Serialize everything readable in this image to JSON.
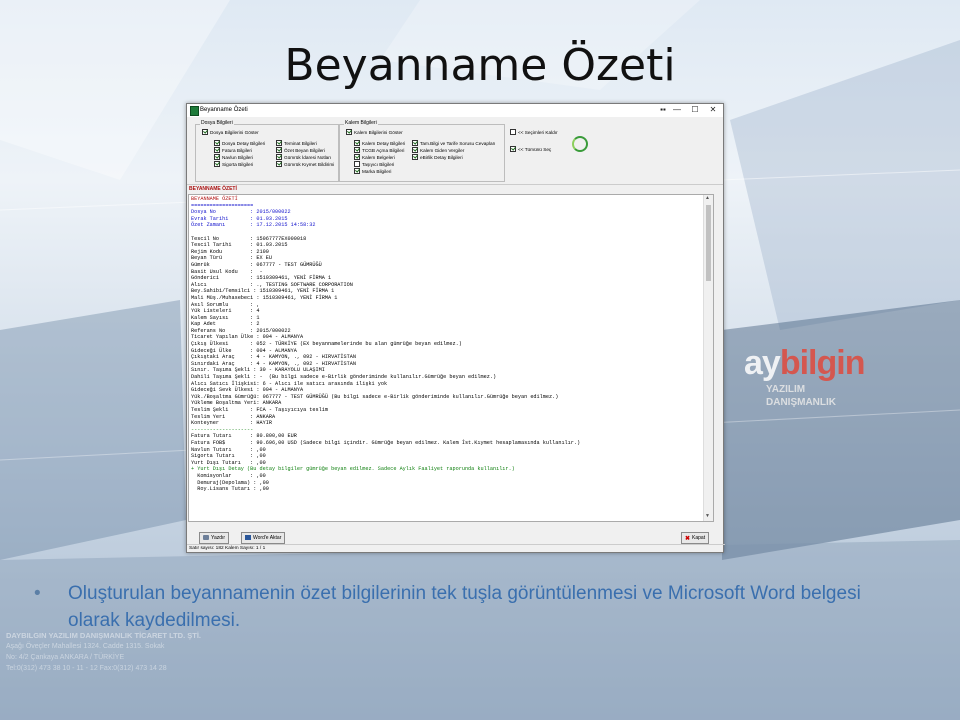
{
  "slide": {
    "title": "Beyanname Özeti",
    "bullet": "Oluşturulan beyannamenin özet bilgilerinin tek tuşla görüntülenmesi ve Microsoft Word belgesi olarak kaydedilmesi.",
    "bullet_mark": "•",
    "watermark_logo_a": "ay",
    "watermark_logo_b": "bilgin",
    "watermark_sub1": "YAZILIM",
    "watermark_sub2": "DANIŞMANLIK",
    "company_lines": [
      "DAYBILGIN YAZILIM DANIŞMANLIK TİCARET LTD. ŞTİ.",
      "Aşağı Öveçler Mahallesi 1324. Cadde 1315. Sokak",
      "No: 4/2 Çankaya ANKARA / TÜRKİYE",
      "Tel:0(312) 473 38 10 - 11 - 12 Fax:0(312) 473 14 28"
    ]
  },
  "window": {
    "title": "Beyanname Özeti",
    "controls": [
      "▪▪",
      "—",
      "☐",
      "✕"
    ],
    "dosya_group": {
      "label": "Dosya Bilgileri",
      "show": "Dosya Bilgilerini Göster",
      "items_left": [
        "Dosya Detay Bilgileri",
        "Fatura Bilgileri",
        "Navlun Bilgileri",
        "Sigorta Bilgileri"
      ],
      "items_right": [
        "Teminat Bilgileri",
        "Özet Beyan Bilgileri",
        "Gümrük İdaresi Notları",
        "Gümrük Kıymet Bildirimi"
      ]
    },
    "kalem_group": {
      "label": "Kalem Bilgileri",
      "show": "Kalem Bilgilerini Göster",
      "items_left": [
        "Kalem Detay Bilgileri",
        "TCGB Açma Bilgileri",
        "Kalem Belgeleri",
        "Taşıyıcı Bilgileri",
        "Marka Bilgileri"
      ],
      "items_right": [
        "Tam.Bilgi ve Tarife Sorusu Cevapları",
        "Kalem Giden Vergiler",
        "eBirlik Detay Bilgileri"
      ]
    },
    "secimleri_kaldir": "<< Seçimleri Kaldır",
    "tumunu_sec": "<< Tümünü Seç",
    "panel_title": "BEYANNAME ÖZETİ",
    "report_lines": [
      {
        "t": "BEYANNAME ÖZETİ",
        "c": "red"
      },
      {
        "t": "====================",
        "c": "blue"
      },
      {
        "t": "Dosya No           : 2015/000022",
        "c": "blue"
      },
      {
        "t": "Evrak Tarihi       : 01.03.2015",
        "c": "blue"
      },
      {
        "t": "Özet Zamanı        : 17.12.2015 14:58:32",
        "c": "blue"
      },
      {
        "t": " ",
        "c": ""
      },
      {
        "t": "Tescil No          : 15067777EX000018",
        "c": ""
      },
      {
        "t": "Tescil Tarihi      : 01.03.2015",
        "c": ""
      },
      {
        "t": "Rejim Kodu         : 2100",
        "c": ""
      },
      {
        "t": "Beyan Türü         : EX EU",
        "c": ""
      },
      {
        "t": "Gümrük             : 067777 - TEST GÜMRÜĞÜ",
        "c": ""
      },
      {
        "t": "Basit Usul Kodu    :  -",
        "c": ""
      },
      {
        "t": "Gönderici          : 1510309461, YENİ FİRMA 1",
        "c": ""
      },
      {
        "t": "Alıcı              : ., TESTING SOFTWARE CORPORATION",
        "c": ""
      },
      {
        "t": "Bey.Sahibi/Temsilci : 1510309461, YENİ FİRMA 1",
        "c": ""
      },
      {
        "t": "Mali Müş./Muhasebeci : 1510309461, YENİ FİRMA 1",
        "c": ""
      },
      {
        "t": "Asıl Sorumlu       : ,",
        "c": ""
      },
      {
        "t": "Yük Listeleri      : 4",
        "c": ""
      },
      {
        "t": "Kalem Sayısı       : 1",
        "c": ""
      },
      {
        "t": "Kap Adet           : 2",
        "c": ""
      },
      {
        "t": "Referans No        : 2015/000022",
        "c": ""
      },
      {
        "t": "Ticaret Yapılan Ülke : 004 - ALMANYA",
        "c": ""
      },
      {
        "t": "Çıkış Ülkesi       : 052 - TÜRKİYE (EX beyannamelerinde bu alan gümrüğe beyan edilmez.)",
        "c": ""
      },
      {
        "t": "Gideceği Ülke      : 004 - ALMANYA",
        "c": ""
      },
      {
        "t": "Çıkıştaki Araç     : 4 - KAMYON, ., 092 - HIRVATİSTAN",
        "c": ""
      },
      {
        "t": "Sınırdaki Araç     : 4 - KAMYON, ., 092 - HIRVATİSTAN",
        "c": ""
      },
      {
        "t": "Sınır. Taşıma Şekli : 30 - KARAYOLU ULAŞIMI",
        "c": ""
      },
      {
        "t": "Dahili Taşıma Şekli : -  (Bu bilgi sadece e-Birlik gönderiminde kullanılır.Gümrüğe beyan edilmez.)",
        "c": ""
      },
      {
        "t": "Alıcı Satıcı İlişkisi: 6 - Alıcı ile satıcı arasında ilişki yok",
        "c": ""
      },
      {
        "t": "Gideceği Sevk Ülkesi : 004 - ALMANYA",
        "c": ""
      },
      {
        "t": "Yük./Boşaltma Gümrüğü: 067777 - TEST GÜMRÜĞÜ (Bu bilgi sadece e-Birlik gönderiminde kullanılır.Gümrüğe beyan edilmez.)",
        "c": ""
      },
      {
        "t": "Yükleme Boşaltma Yeri: ANKARA",
        "c": ""
      },
      {
        "t": "Teslim Şekli       : FCA - Taşıyıcıya teslim",
        "c": ""
      },
      {
        "t": "Teslim Yeri        : ANKARA",
        "c": ""
      },
      {
        "t": "Konteyner          : HAYIR",
        "c": ""
      },
      {
        "t": "--------------------",
        "c": "grn"
      },
      {
        "t": "Fatura Tutarı      : 80.800,00 EUR",
        "c": ""
      },
      {
        "t": "Fatura FOB$        : 90.696,00 USD (Sadece bilgi içindir. Gümrüğe beyan edilmez. Kalem İst.Kıymet hesaplamasında kullanılır.)",
        "c": ""
      },
      {
        "t": "Navlun Tutarı      : ,00",
        "c": ""
      },
      {
        "t": "Sigorta Tutarı     : ,00",
        "c": ""
      },
      {
        "t": "Yurt Dışı Tutarı   : ,00",
        "c": ""
      },
      {
        "t": "+ Yurt Dışı Detay (Bu detay bilgiler gümrüğe beyan edilmez. Sadece Aylık Faaliyet raporunda kullanılır.)",
        "c": "grn"
      },
      {
        "t": "  Komisyonlar      : ,00",
        "c": ""
      },
      {
        "t": "  Demuraj(Depolama) : ,00",
        "c": ""
      },
      {
        "t": "  Roy.Lisans Tutarı : ,00",
        "c": ""
      }
    ],
    "btn_yazdir": "Yazdır",
    "btn_word": "Word'e Aktar",
    "btn_kapat": "Kapat",
    "status": "Satır sayısı: 182   Kalem Sayısı: 1 / 1"
  }
}
